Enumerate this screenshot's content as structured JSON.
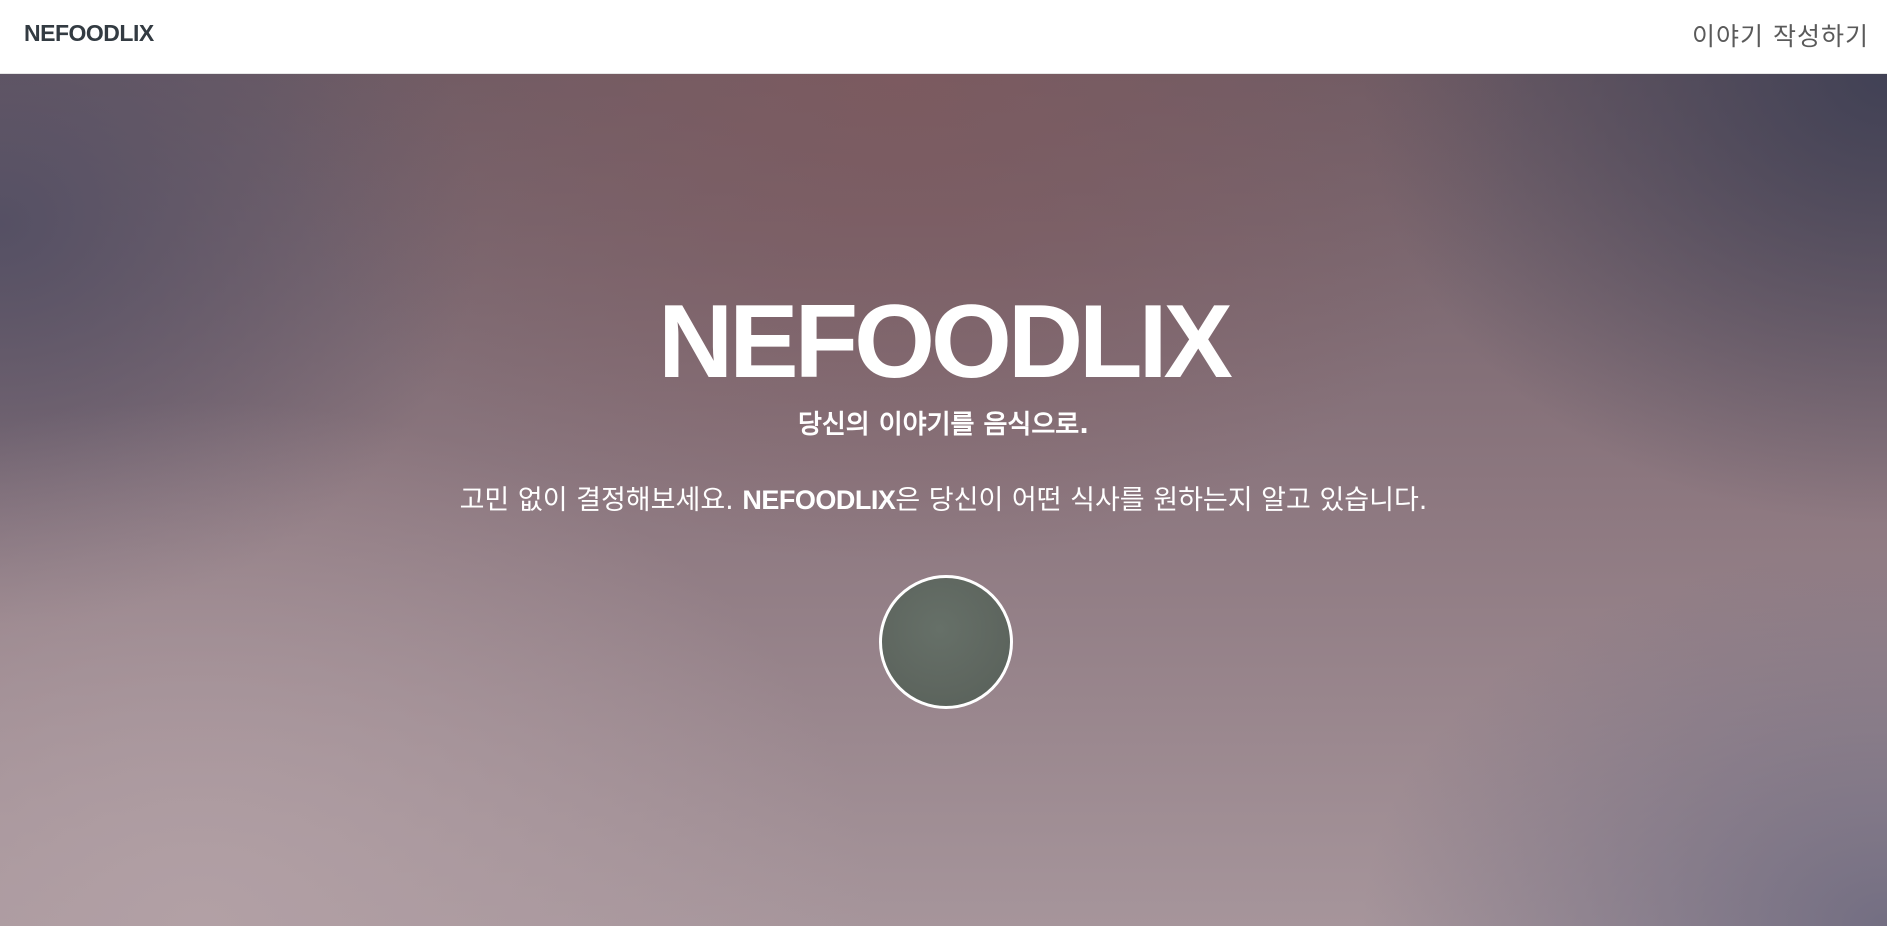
{
  "navbar": {
    "brand": "NEFOODLIX",
    "write_story_link": "이야기 작성하기"
  },
  "hero": {
    "title": "NEFOODLIX",
    "subtitle": "당신의 이야기를 음식으로.",
    "lead_prefix": "고민 없이 결정해보세요. ",
    "lead_brand": "NEFOODLIX",
    "lead_suffix": "은 당신이 어떤 식사를 원하는지 알고 있습니다."
  },
  "colors": {
    "navbar_background": "#ffffff",
    "brand_text": "#333b42",
    "hero_text": "#ffffff",
    "circle_fill": "#5e665f"
  }
}
